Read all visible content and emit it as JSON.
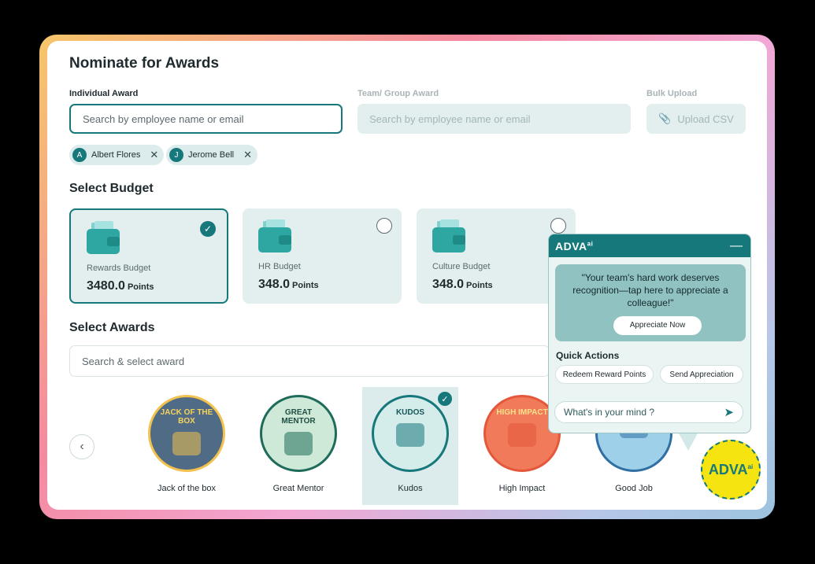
{
  "page": {
    "title": "Nominate for Awards"
  },
  "tabs": {
    "individual": {
      "label": "Individual Award",
      "placeholder": "Search by employee name or email"
    },
    "team": {
      "label": "Team/ Group Award",
      "placeholder": "Search by employee name or email"
    },
    "bulk": {
      "label": "Bulk Upload",
      "button": "Upload CSV"
    }
  },
  "selected_employees": [
    {
      "initial": "A",
      "name": "Albert Flores"
    },
    {
      "initial": "J",
      "name": "Jerome Bell"
    }
  ],
  "budget": {
    "heading": "Select Budget",
    "unit": "Points",
    "items": [
      {
        "name": "Rewards Budget",
        "value": "3480.0",
        "selected": true
      },
      {
        "name": "HR Budget",
        "value": "348.0",
        "selected": false
      },
      {
        "name": "Culture Budget",
        "value": "348.0",
        "selected": false
      }
    ]
  },
  "awards": {
    "heading": "Select Awards",
    "search_placeholder": "Search & select award",
    "items": [
      {
        "badge": "JACK OF THE BOX",
        "name": "Jack of the box",
        "bg": "#4f6b86",
        "ring": "#f2c14e",
        "fg": "#f6d35b"
      },
      {
        "badge": "GREAT MENTOR",
        "name": "Great Mentor",
        "bg": "#cfe9d8",
        "ring": "#1f6b5a",
        "fg": "#1f4e45"
      },
      {
        "badge": "KUDOS",
        "name": "Kudos",
        "bg": "#d4ecea",
        "ring": "#17787b",
        "fg": "#17575a",
        "selected": true
      },
      {
        "badge": "HIGH IMPACT",
        "name": "High Impact",
        "bg": "#f07a5a",
        "ring": "#e4573a",
        "fg": "#fbe08a"
      },
      {
        "badge": "",
        "name": "Good Job",
        "bg": "#9fd0ea",
        "ring": "#2f6fa3",
        "fg": "#2f6fa3"
      }
    ]
  },
  "assistant": {
    "brand": "ADVA",
    "brand_sup": "ai",
    "message": "\"Your team's hard work deserves recognition—tap here to appreciate a colleague!\"",
    "cta": "Appreciate Now",
    "quick_actions_title": "Quick Actions",
    "quick_actions": [
      "Redeem Reward Points",
      "Send Appreciation"
    ],
    "input_placeholder": "What's in your mind ?"
  },
  "colors": {
    "accent": "#17787b",
    "card_bg": "#e3efee",
    "fab": "#f5e40f"
  }
}
